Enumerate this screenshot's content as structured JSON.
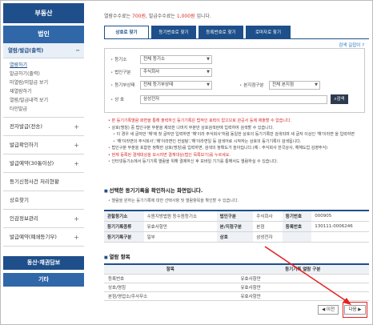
{
  "sidebar": {
    "header": "부동산",
    "section": "법인",
    "open_group": "열람/발급(출력)",
    "open_toggle": "−",
    "children": [
      "열람하기",
      "발급하기(출력)",
      "미열람/미발급 보기",
      "재열람하기",
      "열람/발급내역 보기",
      "타인발급"
    ],
    "items": [
      {
        "label": "전자발급(전송)",
        "toggle": "+"
      },
      {
        "label": "발급확인하기",
        "toggle": "+"
      },
      {
        "label": "발급예약(30통이상)",
        "toggle": "+"
      },
      {
        "label": "등기신청사건 처리현황",
        "toggle": ""
      },
      {
        "label": "상호찾기",
        "toggle": ""
      },
      {
        "label": "인감정보관리",
        "toggle": "+"
      },
      {
        "label": "발급예약(폐쇄등기부)",
        "toggle": "+"
      }
    ],
    "bottom_buttons": [
      "동산·채권담보",
      "기타"
    ]
  },
  "notice": {
    "prefix": "열람수수료는 ",
    "view_fee": "700원",
    "middle": ", 발급수수료는 ",
    "issue_fee": "1,000원",
    "suffix": " 입니다."
  },
  "tabs": [
    {
      "label": "상호로 찾기",
      "active": true
    },
    {
      "label": "등기번호로 찾기",
      "active": false
    },
    {
      "label": "등록번호로 찾기",
      "active": false
    },
    {
      "label": "로마자로 찾기",
      "active": false
    }
  ],
  "guide_link": "검색 길잡이",
  "search_form": {
    "registry_label": "등기소",
    "registry_value": "전체 등기소",
    "corp_type_label": "법인구분",
    "corp_type_value": "주식회사",
    "status_label": "등기부상태",
    "status_value": "전체 등기부상태",
    "branch_label": "본지점구분",
    "branch_value": "전체 본지점",
    "name_label": "상 호",
    "name_value": "삼성전자",
    "search_button": "검색"
  },
  "instructions": [
    {
      "text": "본 등기기록열람 화면을 통해 출력하신 등기기록은 법적인 효력이 없으므로 관공서 등에 제출할 수 없습니다.",
      "red": true
    },
    {
      "text": "상호(명칭) 중 법인구분 부분을 제외한 나머지 부분만 상호검색란에 입력하여 검색할 수 있습니다.",
      "red": false
    },
    {
      "text": "이 경우 새 글자만 '해'에 첫 글자만 입력하면 '해'이라 주식회사'처럼 동일한 상호의 등기기록만 검색되며 새 글자 이상인 '해'이라면 을 입력하면",
      "red": false
    },
    {
      "text": "'해'이라면의 주식회사','해'이라면인 컨설팅','해'이라면일 등 검색어로 시작하는 상호의 등기기록이 검색됩니다.",
      "red": false
    },
    {
      "text": "법인구분 부분을 포함한 정확한 상호(명칭)를 입력하면, 검색의 정확도가 높아집니다.(예 : 주식회사 한국상사, 헤헤도업 김영주식)",
      "red": false
    },
    {
      "text": "현재 등록된 결재대상을 보시려면 결재대상(법인 목록보기)를 누르세요.",
      "red": true
    },
    {
      "text": "인터넷등기소에서 등기기록 열람을 위해 결제하신 후 모바일 기기를 통해서도 열람하실 수 있습니다.",
      "red": false
    }
  ],
  "selected_section": {
    "title": "선택한 등기기록을 확인하시는 화면입니다.",
    "desc": "열람을 원하는 등기기록에 대한 선택사항 및 열람항목을 확인할 수 있습니다.",
    "rows": [
      [
        {
          "v": "관할등기소",
          "th": true
        },
        {
          "v": "수원지방법원 등수원등기소",
          "th": false
        },
        {
          "v": "법인구분",
          "th": true
        },
        {
          "v": "주식회사",
          "th": false
        },
        {
          "v": "등기번호",
          "th": true
        },
        {
          "v": "000905",
          "th": false
        }
      ],
      [
        {
          "v": "등기기록종류",
          "th": true
        },
        {
          "v": "유효사항만",
          "th": false
        },
        {
          "v": "본/지점구분",
          "th": true
        },
        {
          "v": "본점",
          "th": false
        },
        {
          "v": "등록번호",
          "th": true
        },
        {
          "v": "130111-0006246",
          "th": false
        }
      ],
      [
        {
          "v": "등기기록구분",
          "th": true
        },
        {
          "v": "일부",
          "th": false
        },
        {
          "v": "상호",
          "th": true
        },
        {
          "v": "삼성전자",
          "th": false
        },
        {
          "v": "",
          "th": true
        },
        {
          "v": "",
          "th": false
        }
      ]
    ]
  },
  "view_section": {
    "title": "열람 항목",
    "headers": [
      "항목",
      "등기기록 열람 구분"
    ],
    "rows": [
      [
        "등록번호",
        "유효사항만"
      ],
      [
        "상호/명칭",
        "유효사항만"
      ],
      [
        "본점/영업소/주사무소",
        "유효사항만"
      ]
    ]
  },
  "nav": {
    "prev": "◀ 이전",
    "next": "다음 ▶"
  },
  "colors": {
    "primary": "#1e4f8a",
    "highlight": "#e32020"
  }
}
